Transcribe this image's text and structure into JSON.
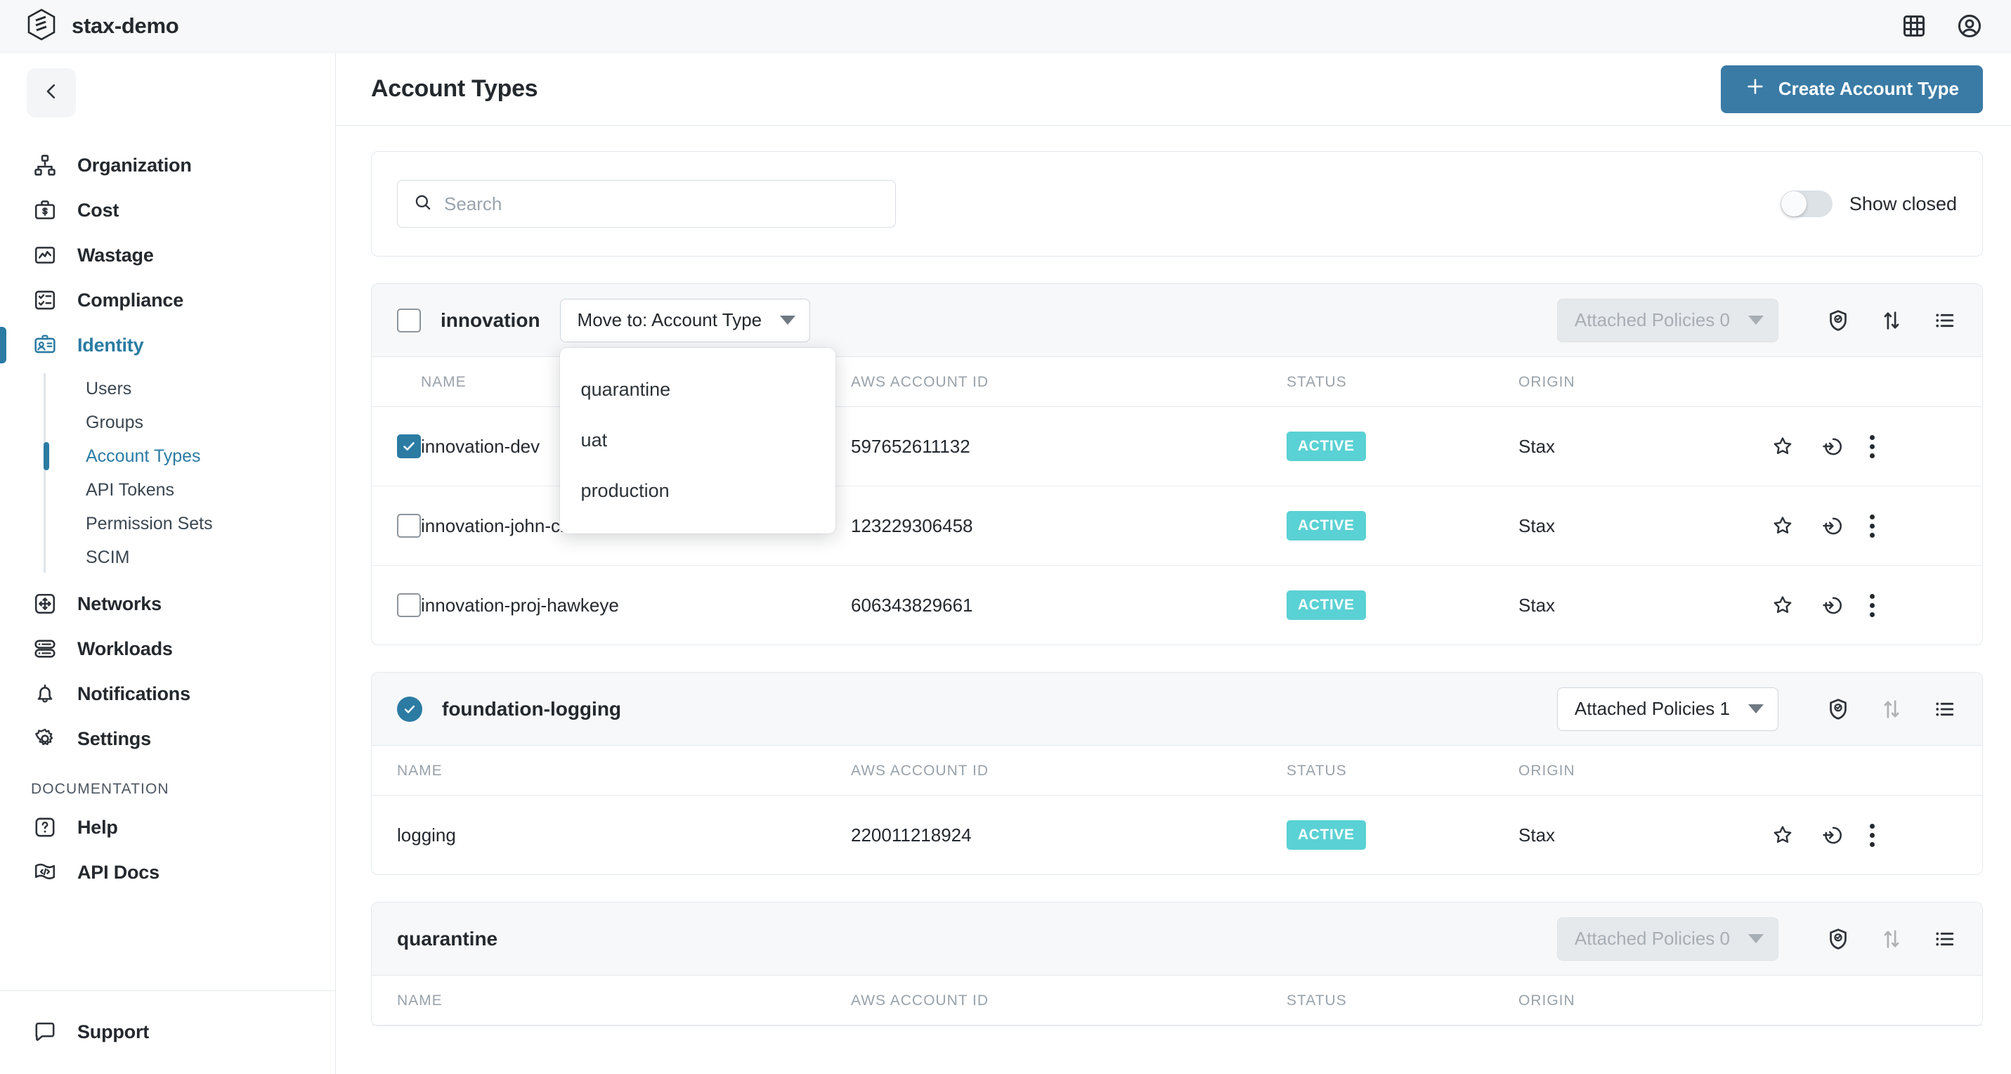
{
  "topbar": {
    "brand": "stax-demo",
    "logo_icon": "stax-hexagon-logo",
    "apps_icon": "grid-apps-icon",
    "account_icon": "user-account-icon"
  },
  "sidebar": {
    "collapse_icon": "chevron-left-icon",
    "items": [
      {
        "label": "Organization",
        "icon": "org-chart-icon",
        "active": false
      },
      {
        "label": "Cost",
        "icon": "briefcase-dollar-icon",
        "active": false
      },
      {
        "label": "Wastage",
        "icon": "chart-line-icon",
        "active": false
      },
      {
        "label": "Compliance",
        "icon": "checklist-icon",
        "active": false
      },
      {
        "label": "Identity",
        "icon": "id-badge-icon",
        "active": true
      }
    ],
    "subitems": [
      {
        "label": "Users",
        "active": false
      },
      {
        "label": "Groups",
        "active": false
      },
      {
        "label": "Account Types",
        "active": true
      },
      {
        "label": "API Tokens",
        "active": false
      },
      {
        "label": "Permission Sets",
        "active": false
      },
      {
        "label": "SCIM",
        "active": false
      }
    ],
    "items_lower": [
      {
        "label": "Networks",
        "icon": "network-move-icon"
      },
      {
        "label": "Workloads",
        "icon": "server-stack-icon"
      },
      {
        "label": "Notifications",
        "icon": "bell-icon"
      },
      {
        "label": "Settings",
        "icon": "gear-icon"
      }
    ],
    "section_label": "DOCUMENTATION",
    "doc_items": [
      {
        "label": "Help",
        "icon": "question-box-icon"
      },
      {
        "label": "API Docs",
        "icon": "code-flag-icon"
      }
    ],
    "support": {
      "label": "Support",
      "icon": "chat-bubble-icon"
    }
  },
  "page": {
    "title": "Account Types",
    "create_button": "Create Account Type",
    "create_icon": "plus-icon"
  },
  "filters": {
    "search_placeholder": "Search",
    "search_value": "",
    "search_icon": "search-icon",
    "show_closed_label": "Show closed",
    "show_closed_on": false
  },
  "table_headers": {
    "name": "NAME",
    "aws_account_id": "AWS ACCOUNT ID",
    "status": "STATUS",
    "origin": "ORIGIN"
  },
  "icons": {
    "shield": "shield-check-icon",
    "sort": "sort-arrows-icon",
    "list": "list-lines-icon",
    "star": "star-icon",
    "signin": "sign-in-circle-icon",
    "more": "more-vertical-icon"
  },
  "move_dropdown": {
    "trigger_label": "Move to: Account Type",
    "open": true,
    "options": [
      "quarantine",
      "uat",
      "production"
    ]
  },
  "groups": [
    {
      "name": "innovation",
      "checkbox": "unchecked",
      "has_checkbox": true,
      "policies_label": "Attached Policies 0",
      "policies_disabled": true,
      "sort_disabled": false,
      "rows": [
        {
          "name": "innovation-dev",
          "account_id": "597652611132",
          "status": "ACTIVE",
          "origin": "Stax",
          "checked": true
        },
        {
          "name": "innovation-john-citizen",
          "account_id": "123229306458",
          "status": "ACTIVE",
          "origin": "Stax",
          "checked": false
        },
        {
          "name": "innovation-proj-hawkeye",
          "account_id": "606343829661",
          "status": "ACTIVE",
          "origin": "Stax",
          "checked": false
        }
      ]
    },
    {
      "name": "foundation-logging",
      "checkbox": "checked-circle",
      "has_checkbox": true,
      "policies_label": "Attached Policies 1",
      "policies_disabled": false,
      "sort_disabled": true,
      "rows": [
        {
          "name": "logging",
          "account_id": "220011218924",
          "status": "ACTIVE",
          "origin": "Stax",
          "checked": false
        }
      ]
    },
    {
      "name": "quarantine",
      "checkbox": "none",
      "has_checkbox": false,
      "policies_label": "Attached Policies 0",
      "policies_disabled": true,
      "sort_disabled": false,
      "rows": []
    }
  ],
  "colors": {
    "accent": "#2b7ba3",
    "primary_button": "#3a7ba5",
    "status_badge": "#5ad1d4",
    "sidebar_bg": "#ffffff",
    "topbar_bg": "#f6f8f9"
  }
}
